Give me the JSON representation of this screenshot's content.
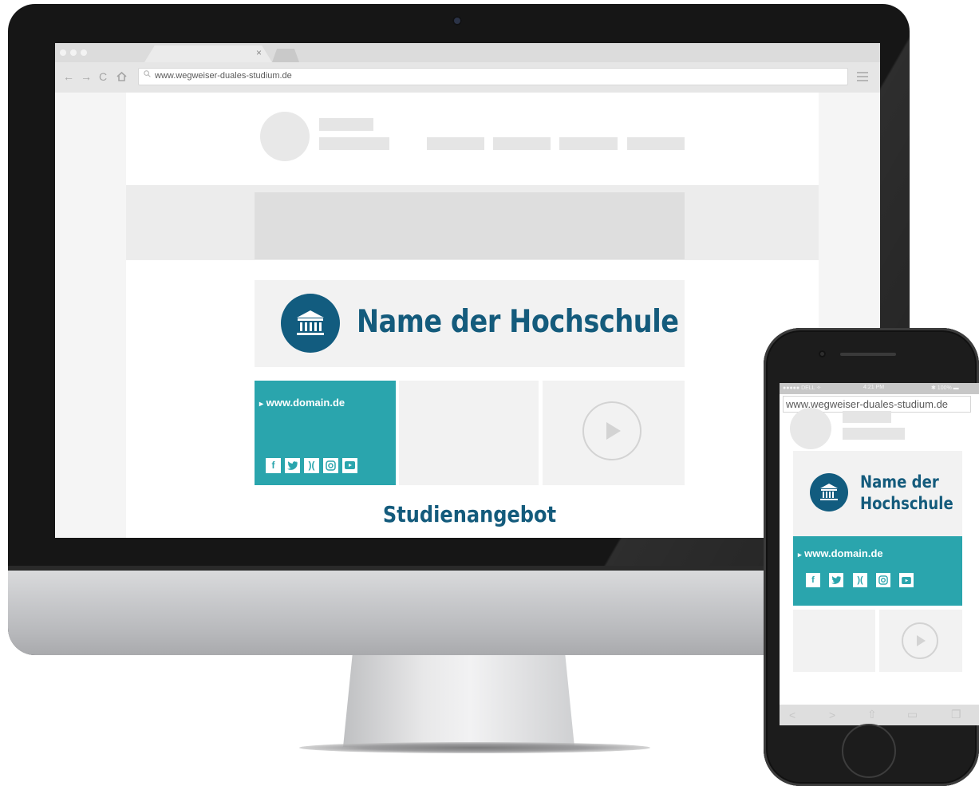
{
  "browser": {
    "url": "www.wegweiser-duales-studium.de",
    "tab_close": "×"
  },
  "page": {
    "university_name": "Name der Hochschule",
    "domain_link": "www.domain.de",
    "domain_arrow": "▸",
    "social_icons": [
      "f",
      "t",
      "x",
      "◎",
      "▶"
    ],
    "study_heading": "Studienangebot"
  },
  "phone": {
    "status_carrier": "●●●●● DELL ✧",
    "status_time": "4:21 PM",
    "status_battery": "✱ 100% ▬",
    "url": "www.wegweiser-duales-studium.de",
    "name_line1": "Name der",
    "name_line2": "Hochschule",
    "domain_link": "www.domain.de",
    "toolbar_icons": [
      "back-icon",
      "forward-icon",
      "share-icon",
      "bookmarks-icon",
      "tabs-icon"
    ]
  },
  "colors": {
    "teal": "#2aa5ad",
    "navy": "#145b7c",
    "skeleton": "#e5e5e5"
  }
}
